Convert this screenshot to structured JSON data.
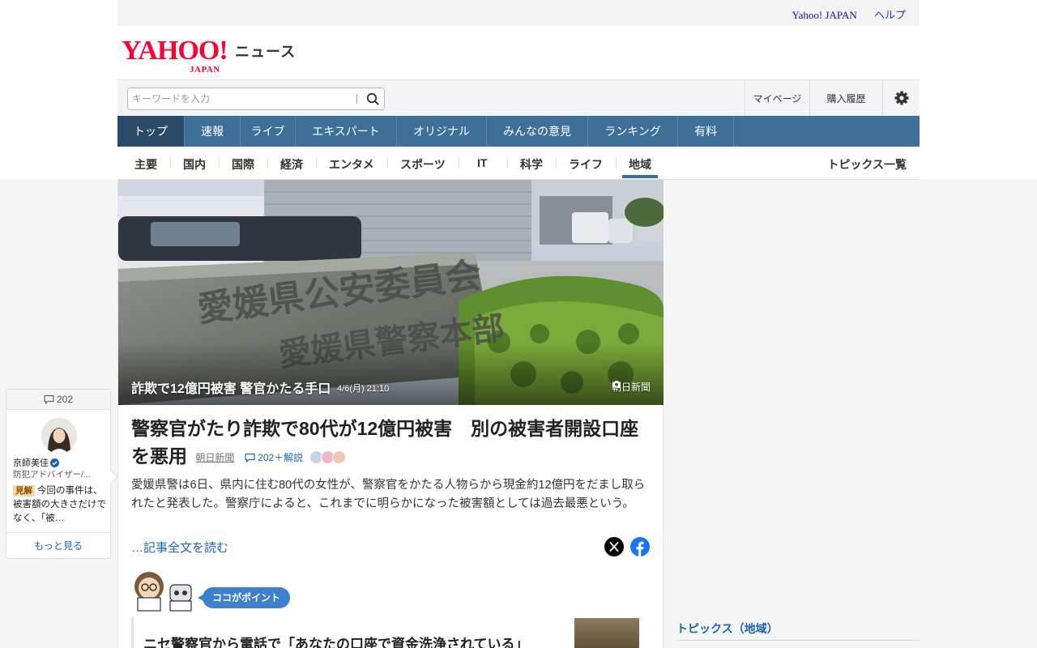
{
  "utility": {
    "yahoo_japan": "Yahoo! JAPAN",
    "help": "ヘルプ"
  },
  "logo": {
    "yahoo": "YAHOO!",
    "japan": "JAPAN",
    "service": "ニュース"
  },
  "search": {
    "placeholder": "キーワードを入力",
    "value": ""
  },
  "header_links": {
    "mypage": "マイページ",
    "history": "購入履歴"
  },
  "main_nav": [
    {
      "label": "トップ",
      "active": true
    },
    {
      "label": "速報",
      "active": false
    },
    {
      "label": "ライブ",
      "active": false
    },
    {
      "label": "エキスパート",
      "active": false
    },
    {
      "label": "オリジナル",
      "active": false
    },
    {
      "label": "みんなの意見",
      "active": false
    },
    {
      "label": "ランキング",
      "active": false
    },
    {
      "label": "有料",
      "active": false
    }
  ],
  "sub_nav": {
    "categories": [
      "主要",
      "国内",
      "国際",
      "経済",
      "エンタメ",
      "スポーツ",
      "IT",
      "科学",
      "ライフ",
      "地域"
    ],
    "active": "地域",
    "topics_all": "トピックス一覧"
  },
  "hero": {
    "sign_text_line1": "愛媛県公安委員会",
    "sign_text_line2": "愛媛県警察本部",
    "caption": "詐欺で12億円被害 警官かたる手口",
    "date": "4/6(月) 21:10",
    "source": "朝日新聞"
  },
  "article": {
    "headline": "警察官がたり詐欺で80代が12億円被害　別の被害者開設口座を悪用",
    "source": "朝日新聞",
    "comments": "202＋解説",
    "summary": "愛媛県警は6日、県内に住む80代の女性が、警察官をかたる人物らから現金約12億円をだまし取られたと発表した。警察庁によると、これまでに明らかになった被害額としては過去最悪という。",
    "read_more": "…記事全文を読む"
  },
  "point": {
    "badge": "ココがポイント",
    "quote": "ニセ警察官から電話で「あなたの口座で資金洗浄されている」"
  },
  "comment_box": {
    "count": "202",
    "name": "京師美佳",
    "role": "防犯アドバイザー/...",
    "tag": "見解",
    "text": "今回の事件は、被害額の大きさだけでなく、「被…",
    "more": "もっと見る"
  },
  "sidebar": {
    "topics_title": "トピックス（地域）"
  },
  "colors": {
    "nav": "#3e6f99",
    "nav_active": "#2a4a68",
    "link": "#1b63b8",
    "brand_red": "#ff0033"
  }
}
